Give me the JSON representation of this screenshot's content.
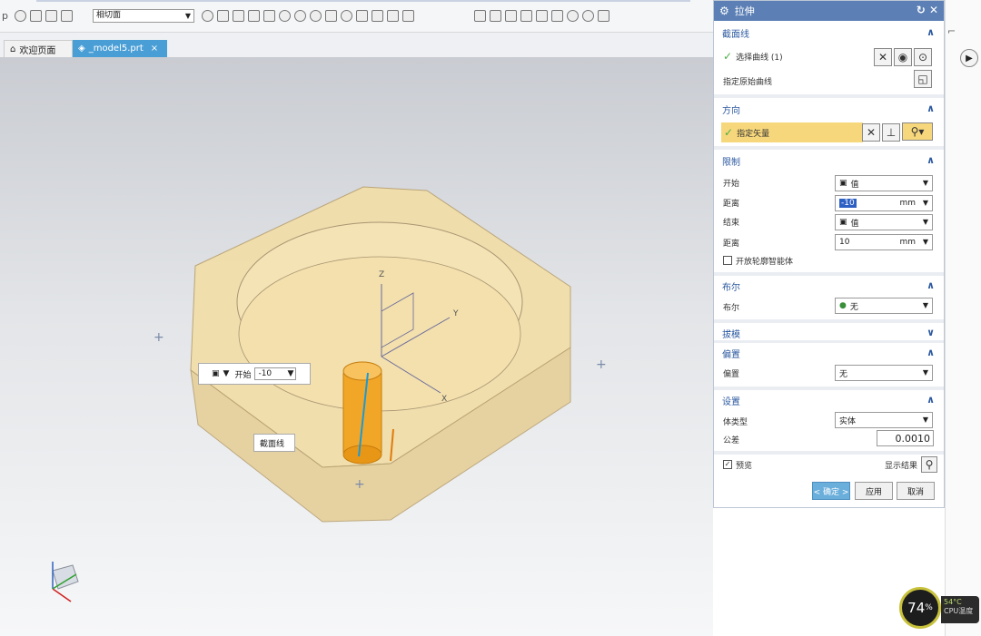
{
  "toolbar": {
    "left_glyph": "p",
    "section_plane_select": "相切面"
  },
  "tabs": [
    {
      "label": "欢迎页面"
    },
    {
      "label": "_model5.prt"
    }
  ],
  "panel": {
    "title": "拉伸",
    "section_curve": {
      "header": "截面线",
      "select_curve": "选择曲线 (1)",
      "specify_origin_curve": "指定原始曲线"
    },
    "direction": {
      "header": "方向",
      "specify_vector": "指定矢量"
    },
    "limits": {
      "header": "限制",
      "start_label": "开始",
      "start_value": "值",
      "distance1_label": "距离",
      "distance1_value": "-10",
      "distance1_unit": "mm",
      "end_label": "结束",
      "end_value": "值",
      "distance2_label": "距离",
      "distance2_value": "10",
      "distance2_unit": "mm",
      "open_profile_label": "开放轮廓智能体"
    },
    "boolean": {
      "header": "布尔",
      "label": "布尔",
      "value": "无"
    },
    "draft": {
      "header": "拔模"
    },
    "offset": {
      "header": "偏置",
      "label": "偏置",
      "value": "无"
    },
    "settings": {
      "header": "设置",
      "body_type_label": "体类型",
      "body_type_value": "实体",
      "tolerance_label": "公差",
      "tolerance_value": "0.0010"
    },
    "preview_label": "预览",
    "show_result_label": "显示结果",
    "buttons": {
      "ok": "< 确定 >",
      "apply": "应用",
      "cancel": "取消"
    }
  },
  "float_toolbar": {
    "start_label": "开始",
    "start_value": "-10"
  },
  "float_label": "截面线",
  "axes": {
    "x": "X",
    "y": "Y",
    "z": "Z"
  },
  "cpu": {
    "percent": "74",
    "unit": "%",
    "temp": "54°C",
    "label": "CPU温度"
  }
}
